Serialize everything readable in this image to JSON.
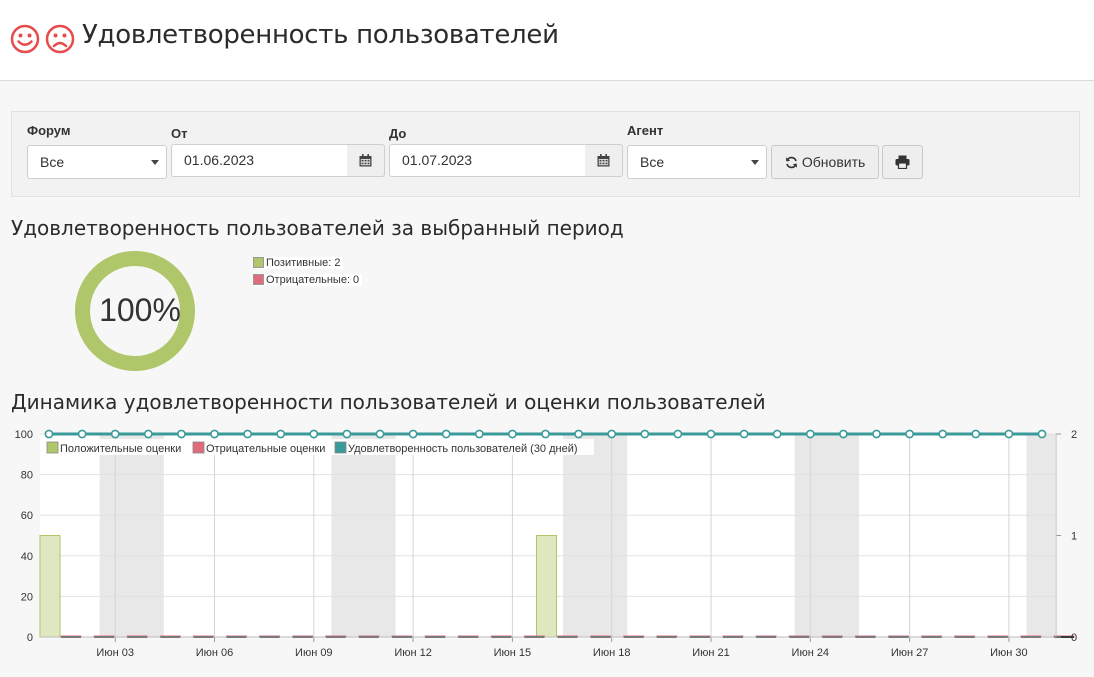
{
  "header": {
    "title": "Удовлетворенность пользователей",
    "icons": [
      "smile-icon",
      "frown-icon"
    ],
    "icon_color": "#e74c4c"
  },
  "filters": {
    "forum": {
      "label": "Форум",
      "value": "Все"
    },
    "from": {
      "label": "От",
      "value": "01.06.2023"
    },
    "to": {
      "label": "До",
      "value": "01.07.2023"
    },
    "agent": {
      "label": "Агент",
      "value": "Все"
    },
    "refresh_label": "Обновить"
  },
  "period": {
    "title": "Удовлетворенность пользователей за выбранный период",
    "percent_label": "100%",
    "positive_legend": "Позитивные: 2",
    "negative_legend": "Отрицательные: 0",
    "positive_color": "#afc66a",
    "negative_color": "#e06b7b"
  },
  "dynamics": {
    "title": "Динамика удовлетворенности пользователей и оценки пользователей"
  },
  "chart_data": {
    "type": "bar",
    "title": "",
    "x": [
      "Июн 01",
      "Июн 02",
      "Июн 03",
      "Июн 04",
      "Июн 05",
      "Июн 06",
      "Июн 07",
      "Июн 08",
      "Июн 09",
      "Июн 10",
      "Июн 11",
      "Июн 12",
      "Июн 13",
      "Июн 14",
      "Июн 15",
      "Июн 16",
      "Июн 17",
      "Июн 18",
      "Июн 19",
      "Июн 20",
      "Июн 21",
      "Июн 22",
      "Июн 23",
      "Июн 24",
      "Июн 25",
      "Июн 26",
      "Июн 27",
      "Июн 28",
      "Июн 29",
      "Июн 30",
      "Июл 01"
    ],
    "x_tick_labels": [
      "Июн 03",
      "Июн 06",
      "Июн 09",
      "Июн 12",
      "Июн 15",
      "Июн 18",
      "Июн 21",
      "Июн 24",
      "Июн 27",
      "Июн 30"
    ],
    "series": [
      {
        "name": "Положительные оценки",
        "type": "bar",
        "axis": "left",
        "color": "#afc66a",
        "values": [
          1,
          0,
          0,
          0,
          0,
          0,
          0,
          0,
          0,
          0,
          0,
          0,
          0,
          0,
          0,
          1,
          0,
          0,
          0,
          0,
          0,
          0,
          0,
          0,
          0,
          0,
          0,
          0,
          0,
          0,
          0
        ]
      },
      {
        "name": "Отрицательные оценки",
        "type": "bar",
        "axis": "left",
        "color": "#e06b7b",
        "values": [
          0,
          0,
          0,
          0,
          0,
          0,
          0,
          0,
          0,
          0,
          0,
          0,
          0,
          0,
          0,
          0,
          0,
          0,
          0,
          0,
          0,
          0,
          0,
          0,
          0,
          0,
          0,
          0,
          0,
          0,
          0
        ]
      },
      {
        "name": "Удовлетворенность пользователей (30 дней)",
        "type": "line",
        "axis": "right",
        "color": "#3a9a9a",
        "values": [
          100,
          100,
          100,
          100,
          100,
          100,
          100,
          100,
          100,
          100,
          100,
          100,
          100,
          100,
          100,
          100,
          100,
          100,
          100,
          100,
          100,
          100,
          100,
          100,
          100,
          100,
          100,
          100,
          100,
          100,
          100
        ]
      }
    ],
    "y_left_ticks": [
      "0",
      "20",
      "40",
      "60",
      "80",
      "100"
    ],
    "y_right_ticks": [
      "0",
      "1",
      "2"
    ],
    "y_left_range": [
      0,
      100
    ],
    "y_right_range": [
      0,
      2
    ],
    "weekend_bands": [
      [
        "Июн 03",
        "Июн 04"
      ],
      [
        "Июн 10",
        "Июн 11"
      ],
      [
        "Июн 17",
        "Июн 18"
      ],
      [
        "Июн 24",
        "Июн 25"
      ],
      [
        "Июл 01",
        "Июл 01"
      ]
    ],
    "grid": true,
    "legend_position": "top-left"
  }
}
